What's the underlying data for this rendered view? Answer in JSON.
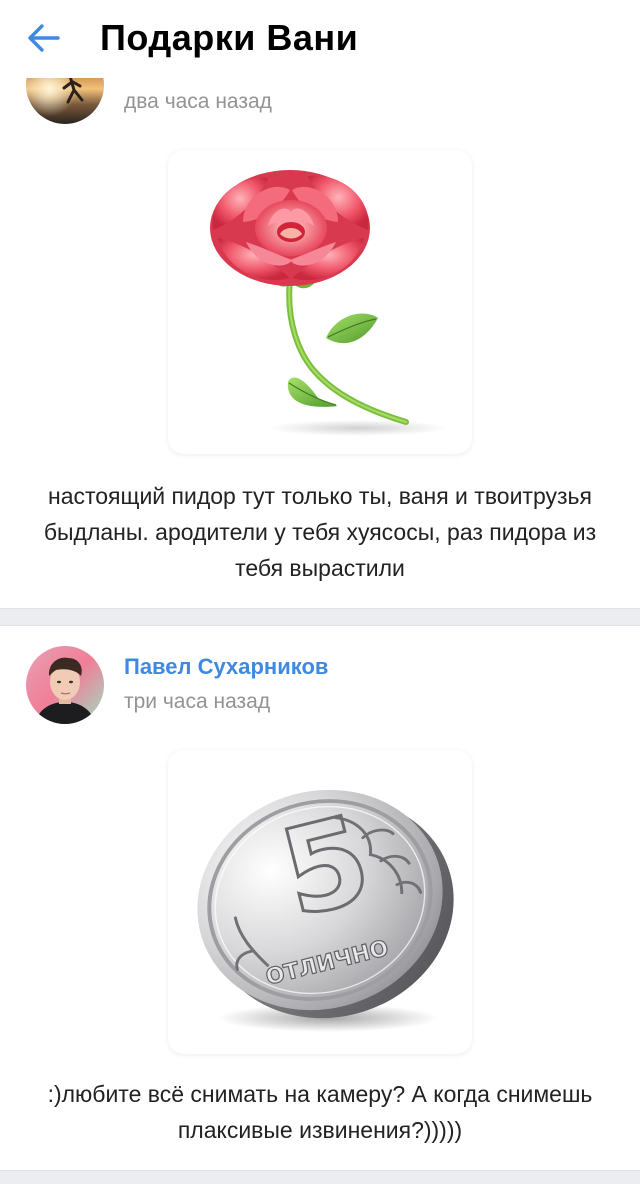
{
  "header": {
    "title": "Подарки Вани",
    "back_icon": "arrow-left-icon",
    "accent_color": "#3f8ae0"
  },
  "posts": [
    {
      "author": "",
      "timestamp": "два часа назад",
      "gift": "rose",
      "message": "настоящий пидор тут только ты, ваня и твоитрузья быдланы. ародители у тебя хуясосы, раз пидора из тебя вырастили"
    },
    {
      "author": "Павел Сухарников",
      "timestamp": "три часа назад",
      "gift": "coin",
      "coin_number": "5",
      "coin_label": "ОТЛИЧНО",
      "message": ":)любите всё снимать на камеру? А когда снимешь плаксивые извинения?)))))"
    }
  ]
}
